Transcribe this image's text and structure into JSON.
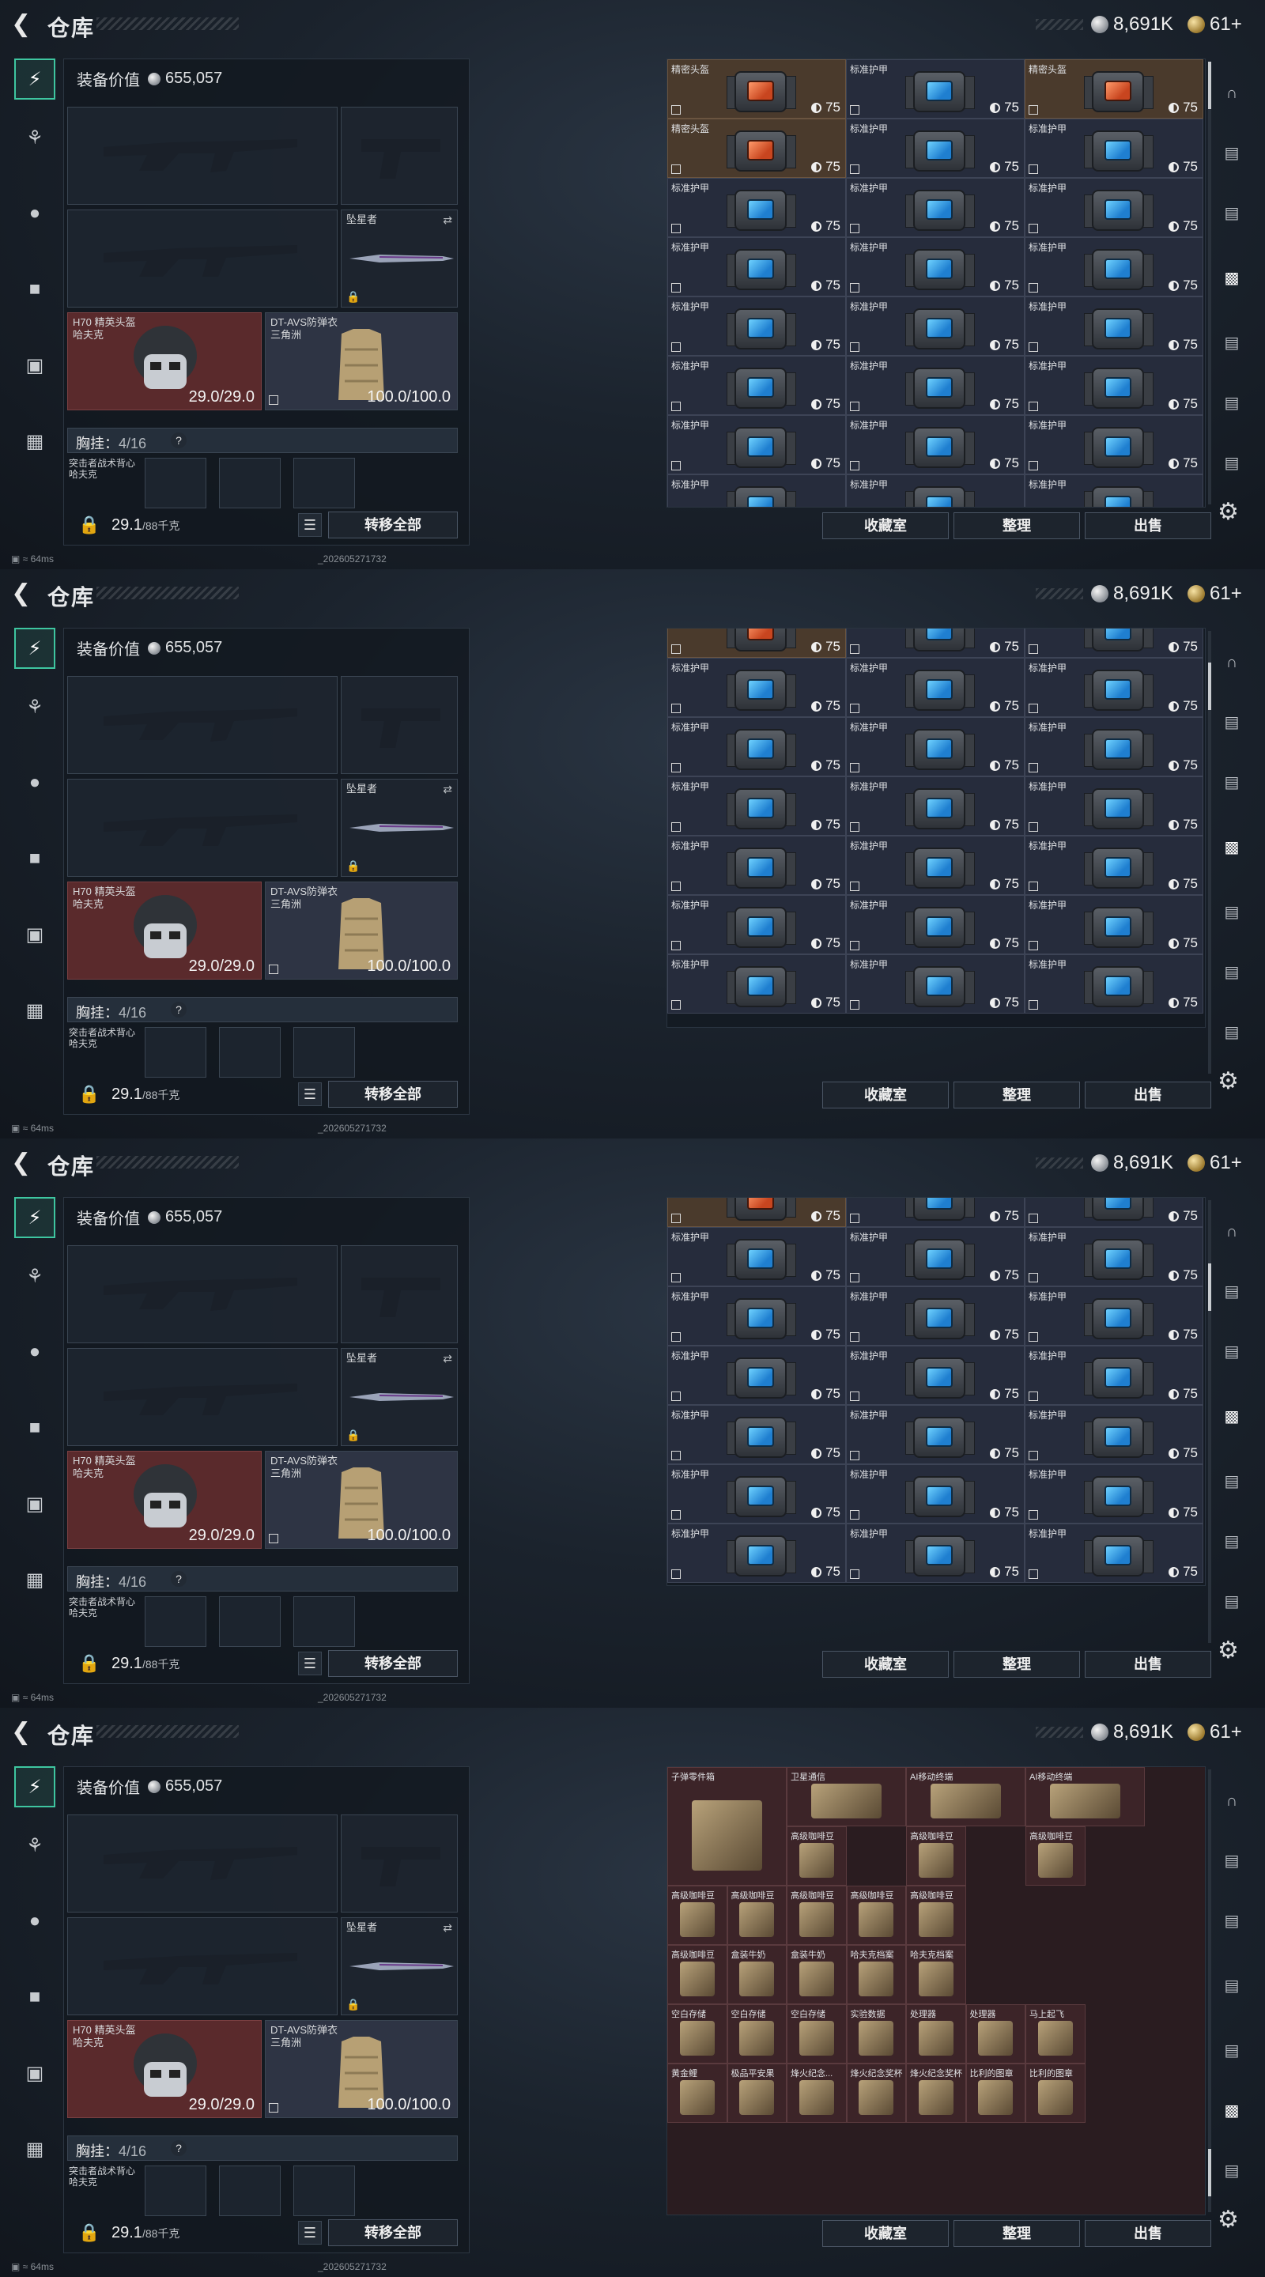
{
  "header": {
    "title": "仓库",
    "currency_primary": "8,691K",
    "currency_secondary": "61+"
  },
  "equipment": {
    "value_label": "装备价值",
    "value": "655,057",
    "melee_label": "坠星者",
    "helmet_name": "H70 精英头盔",
    "helmet_map": "哈夫克",
    "helmet_dur": "29.0/29.0",
    "armor_name": "DT-AVS防弹衣",
    "armor_map": "三角洲",
    "armor_dur": "100.0/100.0",
    "chest_label": "胸挂：",
    "chest_count": "4/16",
    "help_symbol": "?",
    "vest_slot_label": "突击者战术背心",
    "vest_slot_sub": "哈夫克",
    "weight": "29.1",
    "weight_unit": "/88千克",
    "transfer_label": "转移全部"
  },
  "status": {
    "ping": "64ms",
    "build": "_202605271732"
  },
  "storage": {
    "buttons": [
      "收藏室",
      "整理",
      "出售"
    ],
    "durability": "75",
    "helmet_item": "精密头盔",
    "armor_item": "标准护甲"
  },
  "misc_items": [
    {
      "name": "子弹零件箱"
    },
    {
      "name": "卫星通信"
    },
    {
      "name": "AI移动终端"
    },
    {
      "name": "AI移动终端"
    },
    {
      "name": "高级咖啡豆"
    },
    {
      "name": "高级咖啡豆"
    },
    {
      "name": "高级咖啡豆"
    },
    {
      "name": "高级咖啡豆"
    },
    {
      "name": "高级咖啡豆"
    },
    {
      "name": "高级咖啡豆"
    },
    {
      "name": "高级咖啡豆"
    },
    {
      "name": "高级咖啡豆"
    },
    {
      "name": "高级咖啡豆"
    },
    {
      "name": "盒装牛奶"
    },
    {
      "name": "盒装牛奶"
    },
    {
      "name": "哈夫克档案"
    },
    {
      "name": "哈夫克档案"
    },
    {
      "name": "空白存储"
    },
    {
      "name": "空白存储"
    },
    {
      "name": "空白存储"
    },
    {
      "name": "实验数据"
    },
    {
      "name": "处理器"
    },
    {
      "name": "处理器"
    },
    {
      "name": "马上起飞"
    },
    {
      "name": "黄金鲤"
    },
    {
      "name": "极品平安果"
    },
    {
      "name": "烽火纪念..."
    },
    {
      "name": "烽火纪念奖杯"
    },
    {
      "name": "烽火纪念奖杯"
    },
    {
      "name": "比利的图章"
    },
    {
      "name": "比利的图章"
    },
    {
      "name": "比利的图章"
    },
    {
      "name": "比利的图章"
    }
  ]
}
